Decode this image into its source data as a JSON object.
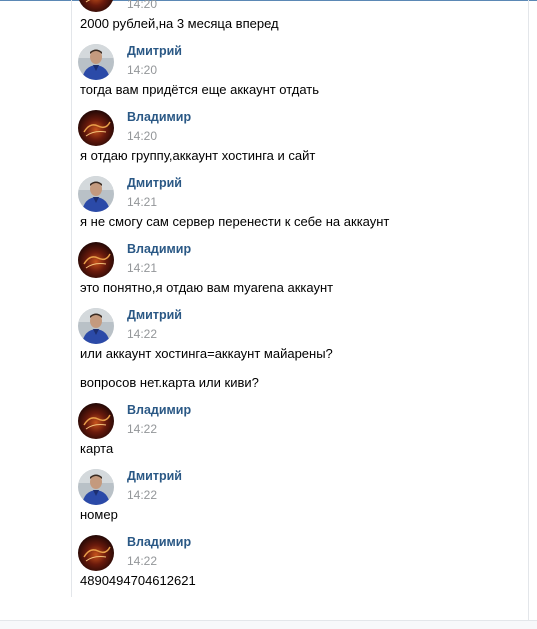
{
  "first_message": {
    "time": "14:20",
    "text": "2000 рублей,на 3 месяца вперед"
  },
  "messages": [
    {
      "author": "Дмитрий",
      "time": "14:20",
      "text": "тогда вам придётся еще аккаунт отдать"
    },
    {
      "author": "Владимир",
      "time": "14:20",
      "text": "я отдаю группу,аккаунт хостинга и сайт"
    },
    {
      "author": "Дмитрий",
      "time": "14:21",
      "text": "я не смогу сам сервер перенести к себе на аккаунт"
    },
    {
      "author": "Владимир",
      "time": "14:21",
      "text": "это понятно,я отдаю вам myarena аккаунт"
    },
    {
      "author": "Дмитрий",
      "time": "14:22",
      "text": "или аккаунт хостинга=аккаунт майарены?",
      "text2": "вопросов нет.карта или киви?"
    },
    {
      "author": "Владимир",
      "time": "14:22",
      "text": "карта"
    },
    {
      "author": "Дмитрий",
      "time": "14:22",
      "text": "номер"
    },
    {
      "author": "Владимир",
      "time": "14:22",
      "text": "4890494704612621"
    }
  ],
  "colors": {
    "author_link": "#2a5885",
    "timestamp": "#939699",
    "message_text": "#000000",
    "header_accent": "#5b88b5"
  }
}
